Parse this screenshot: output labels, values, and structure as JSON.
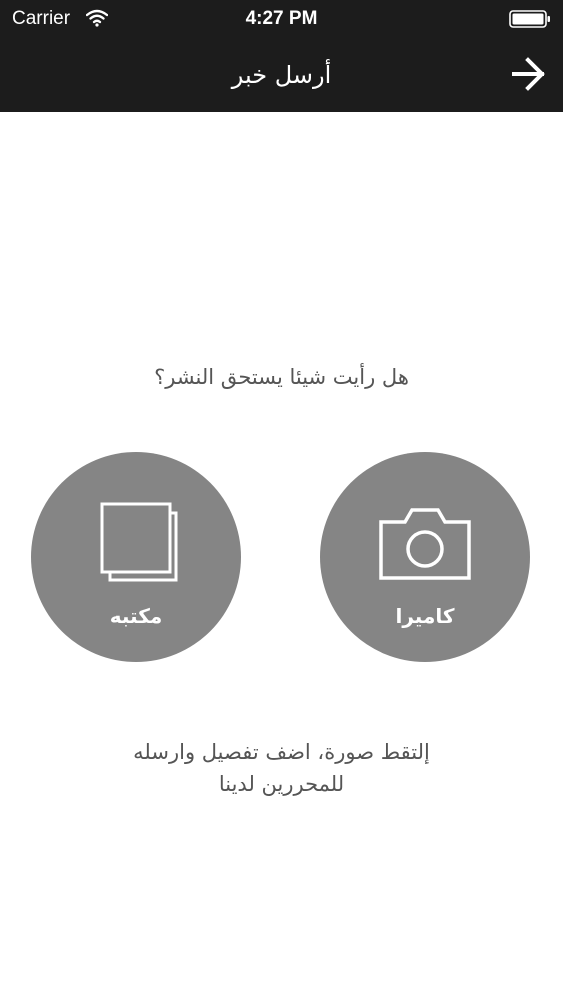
{
  "status_bar": {
    "carrier": "Carrier",
    "time": "4:27 PM"
  },
  "nav": {
    "title": "أرسل خبر",
    "forward_icon": "arrow-right-icon"
  },
  "main": {
    "prompt": "هل رأيت شيئا يستحق النشر؟",
    "buttons": {
      "camera": {
        "label": "كاميرا",
        "icon": "camera-icon"
      },
      "library": {
        "label": "مكتبه",
        "icon": "photo-library-icon"
      }
    },
    "instructions": {
      "line1": "إلتقط صورة، اضف تفصيل وارسله",
      "line2": "للمحررين لدينا"
    }
  },
  "colors": {
    "top_bar": "#1c1c1c",
    "circle": "#858585",
    "text": "#555555"
  }
}
